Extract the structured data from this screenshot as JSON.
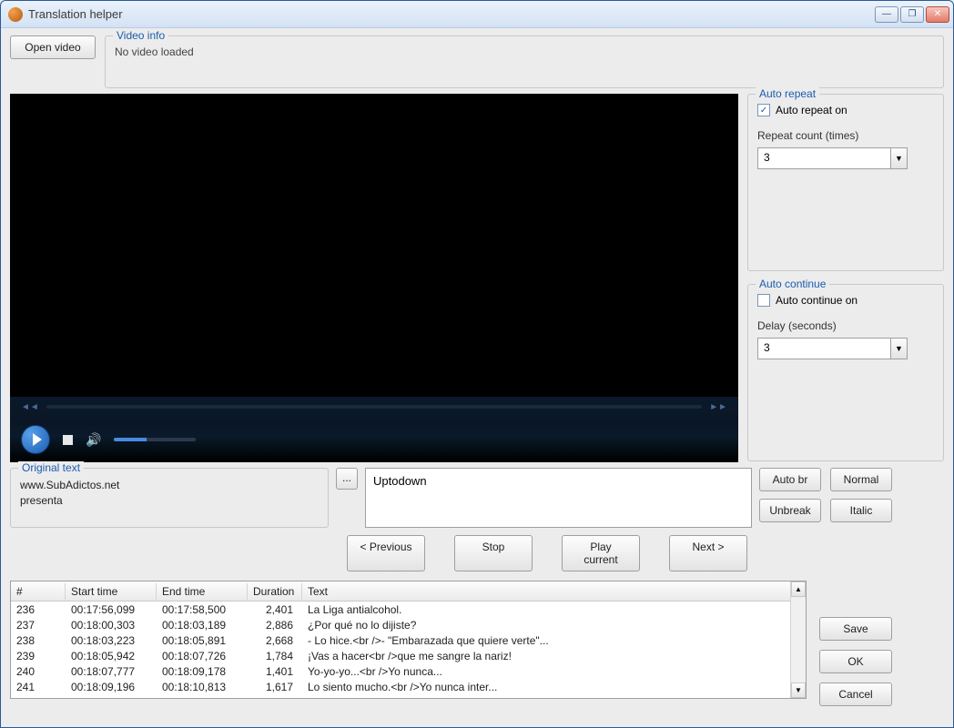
{
  "window": {
    "title": "Translation helper"
  },
  "buttons": {
    "open_video": "Open video",
    "auto_br": "Auto br",
    "normal": "Normal",
    "unbreak": "Unbreak",
    "italic": "Italic",
    "previous": "< Previous",
    "stop": "Stop",
    "play_current": "Play current",
    "next": "Next >",
    "save": "Save",
    "ok": "OK",
    "cancel": "Cancel",
    "browse": "..."
  },
  "video_info": {
    "legend": "Video info",
    "status": "No video loaded"
  },
  "auto_repeat": {
    "legend": "Auto repeat",
    "checkbox_label": "Auto repeat on",
    "checked": true,
    "count_label": "Repeat count (times)",
    "count_value": "3"
  },
  "auto_continue": {
    "legend": "Auto continue",
    "checkbox_label": "Auto continue on",
    "checked": false,
    "delay_label": "Delay (seconds)",
    "delay_value": "3"
  },
  "original_text": {
    "legend": "Original text",
    "line1": "www.SubAdictos.net",
    "line2": "presenta"
  },
  "translation": {
    "value": "Uptodown"
  },
  "table": {
    "headers": {
      "num": "#",
      "start": "Start time",
      "end": "End time",
      "duration": "Duration",
      "text": "Text"
    },
    "rows": [
      {
        "num": "236",
        "start": "00:17:56,099",
        "end": "00:17:58,500",
        "dur": "2,401",
        "text": "La Liga antialcohol."
      },
      {
        "num": "237",
        "start": "00:18:00,303",
        "end": "00:18:03,189",
        "dur": "2,886",
        "text": "¿Por qué no lo dijiste?"
      },
      {
        "num": "238",
        "start": "00:18:03,223",
        "end": "00:18:05,891",
        "dur": "2,668",
        "text": "- Lo hice.<br />- \"Embarazada que quiere verte\"..."
      },
      {
        "num": "239",
        "start": "00:18:05,942",
        "end": "00:18:07,726",
        "dur": "1,784",
        "text": "¡Vas a hacer<br />que me sangre la nariz!"
      },
      {
        "num": "240",
        "start": "00:18:07,777",
        "end": "00:18:09,178",
        "dur": "1,401",
        "text": "Yo-yo-yo...<br />Yo nunca..."
      },
      {
        "num": "241",
        "start": "00:18:09,196",
        "end": "00:18:10,813",
        "dur": "1,617",
        "text": "Lo siento mucho.<br />Yo nunca inter..."
      }
    ]
  }
}
